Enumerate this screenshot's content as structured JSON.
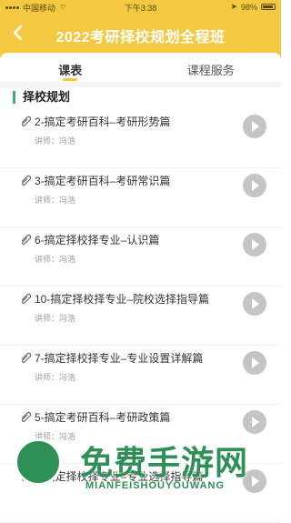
{
  "status_bar": {
    "carrier": "中国移动",
    "time": "下午3:38",
    "battery": "98%"
  },
  "header": {
    "title": "2022考研择校规划全程班"
  },
  "tabs": [
    {
      "label": "课表"
    },
    {
      "label": "课程服务"
    }
  ],
  "section": {
    "title": "择校规划"
  },
  "lessons": [
    {
      "title": "2-搞定考研百科–考研形势篇",
      "teacher": "讲师：冯浩"
    },
    {
      "title": "3-搞定考研百科–考研常识篇",
      "teacher": "讲师：冯浩"
    },
    {
      "title": "6-搞定择校择专业–认识篇",
      "teacher": "讲师：冯浩"
    },
    {
      "title": "10-搞定择校择专业–院校选择指导篇",
      "teacher": "讲师：冯浩"
    },
    {
      "title": "7-搞定择校择专业–专业设置详解篇",
      "teacher": "讲师：冯浩"
    },
    {
      "title": "5-搞定考研百科–考研政策篇",
      "teacher": "讲师：冯浩"
    },
    {
      "title": "8-搞定择校择专业–专业选择指导篇",
      "teacher": ""
    }
  ],
  "watermark": {
    "main": "免费手游网",
    "sub": "MIANFEISHOUYOUWANG"
  },
  "colors": {
    "accent": "#f5c842",
    "section_bar": "#33b37a",
    "play": "#c4c4c4"
  },
  "icons": {
    "back": "chevron-left-icon",
    "lesson": "paperclip-icon",
    "play": "play-icon"
  }
}
